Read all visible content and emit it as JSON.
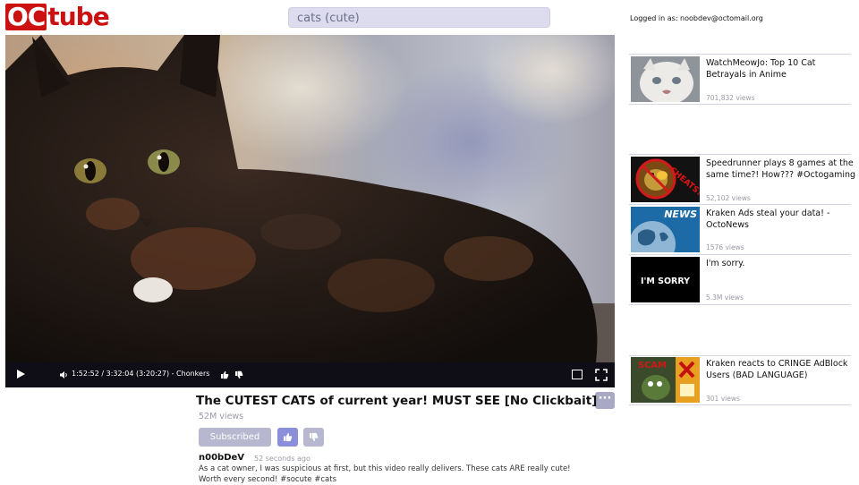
{
  "logo": {
    "part1": "OC",
    "part2": "tube"
  },
  "search": {
    "value": "cats (cute)"
  },
  "login": {
    "text": "Logged in as: noobdev@octomail.org"
  },
  "player": {
    "time": "1:52:52 / 3:32:04 (3:20:27) - Chonkers"
  },
  "video": {
    "title": "The CUTEST CATS of current year! MUST SEE [No Clickbait]",
    "views": "52M views",
    "subscribe_label": "Subscribed",
    "more_label": "···",
    "channel": "n00bDeV",
    "posted": "52 seconds ago",
    "description": "As a cat owner, I was suspicious at first, but this video really delivers. These cats ARE really cute! Worth every second! #socute #cats"
  },
  "sidebar": {
    "items": [
      {
        "title": "WatchMeowJo: Top 10 Cat Betrayals in Anime",
        "views": "701,832 views",
        "thumb": "sad-cat"
      },
      {
        "title": "Speedrunner plays 8 games at the same time?! How??? #Octogaming",
        "views": "52,102 views",
        "thumb": "cheats",
        "thumb_text": "CHEATS?"
      },
      {
        "title": "Kraken Ads steal your data! - OctoNews",
        "views": "1576 views",
        "thumb": "news",
        "thumb_text": "NEWS"
      },
      {
        "title": "I'm sorry.",
        "views": "5.3M views",
        "thumb": "sorry",
        "thumb_text": "I'M SORRY"
      },
      {
        "title": "Kraken reacts to CRINGE AdBlock Users (BAD LANGUAGE)",
        "views": "301 views",
        "thumb": "kraken",
        "thumb_text": "SCAM"
      }
    ]
  },
  "colors": {
    "brand": "#cc1111",
    "controls_bg": "#0f0e16",
    "button_muted": "#b7b7cf",
    "button_accent": "#8b8ed8"
  }
}
